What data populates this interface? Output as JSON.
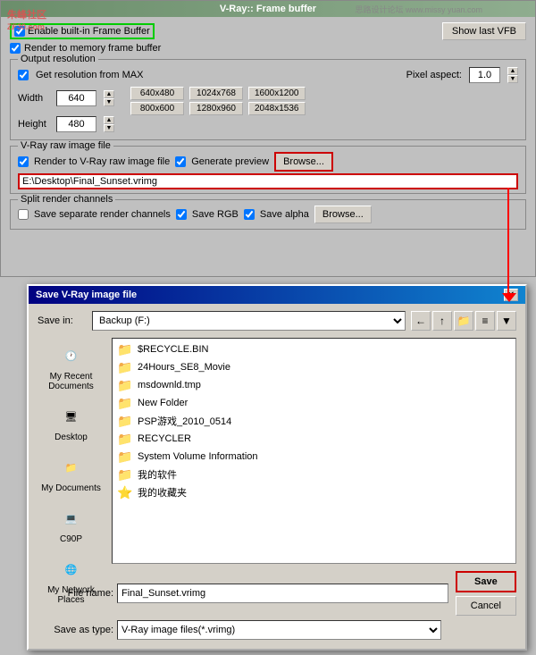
{
  "watermark": {
    "site": "朱峰社区",
    "sub": "ZF30.com",
    "top_right": "思路设计论坛 www.missy yuan.com"
  },
  "vray": {
    "title": "V-Ray:: Frame buffer",
    "show_vfb_label": "Show last VFB",
    "enable_fb_label": "Enable built-in Frame Buffer",
    "render_memory_label": "Render to memory frame buffer",
    "output_resolution_label": "Output resolution",
    "get_resolution_label": "Get resolution from MAX",
    "pixel_aspect_label": "Pixel aspect:",
    "pixel_aspect_value": "1.0",
    "width_label": "Width",
    "width_value": "640",
    "height_label": "Height",
    "height_value": "480",
    "presets": {
      "row1": [
        "640x480",
        "1024x768",
        "1600x1200"
      ],
      "row2": [
        "800x600",
        "1280x960",
        "2048x1536"
      ]
    },
    "raw_image_label": "V-Ray raw image file",
    "render_to_raw_label": "Render to V-Ray raw image file",
    "generate_preview_label": "Generate preview",
    "browse_label": "Browse...",
    "path_value": "E:\\Desktop\\Final_Sunset.vrimg",
    "split_render_label": "Split render channels",
    "save_separate_label": "Save separate render channels",
    "save_rgb_label": "Save RGB",
    "save_alpha_label": "Save alpha",
    "browse2_label": "Browse..."
  },
  "save_dialog": {
    "title": "Save V-Ray image file",
    "save_in_label": "Save in:",
    "save_in_value": "Backup (F:)",
    "close_btn": "✕",
    "sidebar_items": [
      {
        "id": "recent",
        "label": "My Recent\nDocuments",
        "icon": "🕐"
      },
      {
        "id": "desktop",
        "label": "Desktop",
        "icon": "🖥"
      },
      {
        "id": "mydocs",
        "label": "My Documents",
        "icon": "📁"
      },
      {
        "id": "c90p",
        "label": "C90P",
        "icon": "💻"
      },
      {
        "id": "network",
        "label": "My Network\nPlaces",
        "icon": "🌐"
      }
    ],
    "files": [
      {
        "name": "$RECYCLE.BIN",
        "icon": "📁"
      },
      {
        "name": "24Hours_SE8_Movie",
        "icon": "📁"
      },
      {
        "name": "msdownld.tmp",
        "icon": "📁"
      },
      {
        "name": "New Folder",
        "icon": "📁"
      },
      {
        "name": "PSP游戏_2010_0514",
        "icon": "📁"
      },
      {
        "name": "RECYCLER",
        "icon": "📁"
      },
      {
        "name": "System Volume Information",
        "icon": "📁"
      },
      {
        "name": "我的软件",
        "icon": "📁"
      },
      {
        "name": "我的收藏夹",
        "icon": "⭐"
      }
    ],
    "file_name_label": "File name:",
    "file_name_value": "Final_Sunset.vrimg",
    "save_type_label": "Save as type:",
    "save_type_value": "V-Ray image files(*.vrimg)",
    "save_btn": "Save",
    "cancel_btn": "Cancel"
  }
}
